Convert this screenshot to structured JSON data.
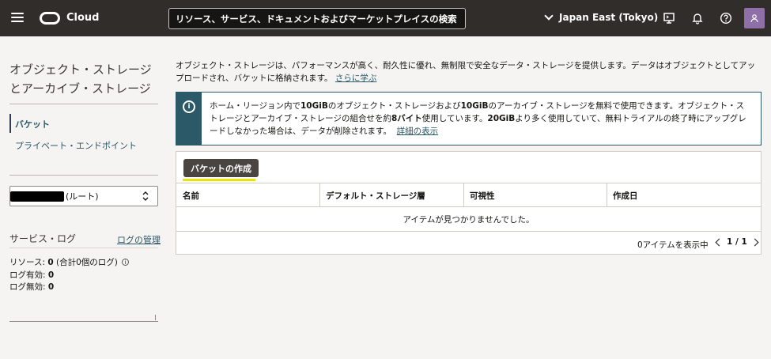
{
  "topbar": {
    "brand": "Cloud",
    "search_placeholder": "リソース、サービス、ドキュメントおよびマーケットプレイスの検索",
    "region": "Japan East (Tokyo)"
  },
  "sidebar": {
    "title_line1": "オブジェクト・ストレージ",
    "title_line2": "とアーカイブ・ストレージ",
    "nav": [
      {
        "label": "バケット",
        "active": true
      },
      {
        "label": "プライベート・エンドポイント",
        "active": false
      }
    ],
    "compartment": "(ルート)",
    "service_logs": {
      "title": "サービス・ログ",
      "manage_link": "ログの管理",
      "resources_label": "リソース:",
      "resources_value": "0",
      "resources_detail": "(合計0個のログ)",
      "enabled_label": "ログ有効:",
      "enabled_value": "0",
      "disabled_label": "ログ無効:",
      "disabled_value": "0"
    }
  },
  "main": {
    "intro": "オブジェクト・ストレージは、パフォーマンスが高く、耐久性に優れ、無制限で安全なデータ・ストレージを提供します。データはオブジェクトとしてアップロードされ、バケットに格納されます。",
    "intro_link": "さらに学ぶ",
    "info": {
      "t1": "ホーム・リージョン内で",
      "b1": "10GiB",
      "t2": "のオブジェクト・ストレージおよび",
      "b2": "10GiB",
      "t3": "のアーカイブ・ストレージを無料で使用できます。オブジェクト・ストレージとアーカイブ・ストレージの組合せを約",
      "b3": "8バイト",
      "t4": "使用しています。",
      "b4": "20GiB",
      "t5": "より多く使用していて、無料トライアルの終了時にアップグレードしなかった場合は、データが削除されます。",
      "link": "詳細の表示"
    },
    "create_button": "バケットの作成",
    "columns": [
      "名前",
      "デフォルト・ストレージ層",
      "可視性",
      "作成日"
    ],
    "empty_message": "アイテムが見つかりませんでした。",
    "items_count": "0アイテムを表示中",
    "pagination": "1 / 1"
  },
  "colors": {
    "header_bg": "#312d2a",
    "link": "#2c5967",
    "highlight": "#f0e500",
    "button_bg": "#4a4541"
  }
}
